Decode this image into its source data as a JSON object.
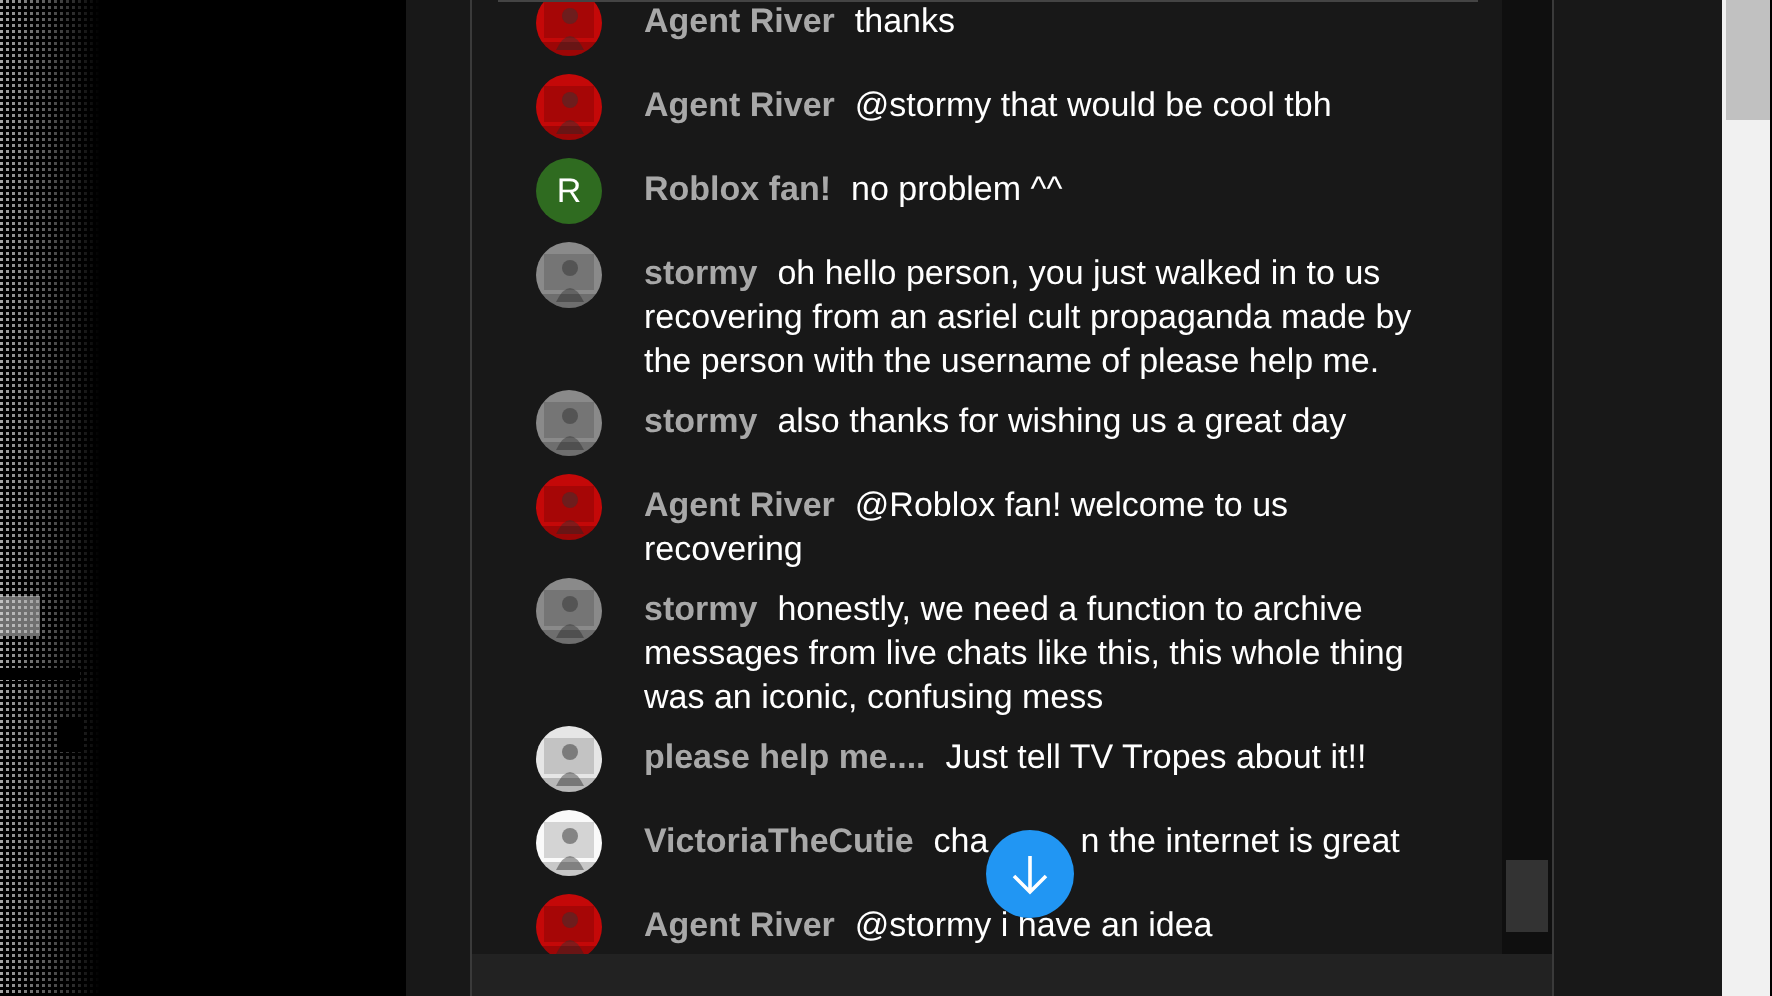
{
  "messages": [
    {
      "author": "Agent River",
      "text": "thanks"
    },
    {
      "author": "Agent River",
      "text": "@stormy that would be cool tbh"
    },
    {
      "author": "Roblox fan!",
      "text": "no problem ^^",
      "avatar": {
        "kind": "letter",
        "letter": "R",
        "color": "#2f6b20"
      }
    },
    {
      "author": "stormy",
      "text": "oh hello person, you just walked in to us recovering from an asriel cult propaganda made by the person with the username of please help me."
    },
    {
      "author": "stormy",
      "text": "also thanks for wishing us a great day"
    },
    {
      "author": "Agent River",
      "text": "@Roblox fan! welcome to us recovering"
    },
    {
      "author": "stormy",
      "text": "honestly, we need a function to archive messages from live chats like this, this whole thing was an iconic, confusing mess"
    },
    {
      "author": "please help me....",
      "text": "Just tell TV Tropes about it!!"
    },
    {
      "author": "VictoriaTheCutie",
      "text_parts": [
        "cha",
        "n the internet is great"
      ]
    },
    {
      "author": "Agent River",
      "text": "@stormy i have an idea"
    }
  ]
}
